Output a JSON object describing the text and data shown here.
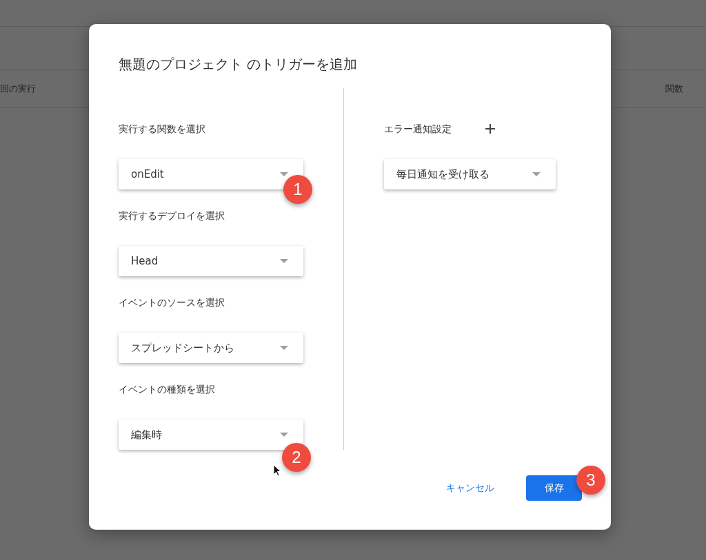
{
  "background": {
    "columns": [
      "回の実行",
      "関数"
    ]
  },
  "dialog": {
    "title": "無題のプロジェクト のトリガーを追加",
    "fields": [
      {
        "label": "実行する関数を選択",
        "value": "onEdit"
      },
      {
        "label": "実行するデプロイを選択",
        "value": "Head"
      },
      {
        "label": "イベントのソースを選択",
        "value": "スプレッドシートから"
      },
      {
        "label": "イベントの種類を選択",
        "value": "編集時"
      }
    ],
    "error_settings": {
      "label": "エラー通知設定",
      "value": "毎日通知を受け取る"
    },
    "buttons": {
      "cancel": "キャンセル",
      "save": "保存"
    }
  },
  "markers": [
    "1",
    "2",
    "3"
  ]
}
